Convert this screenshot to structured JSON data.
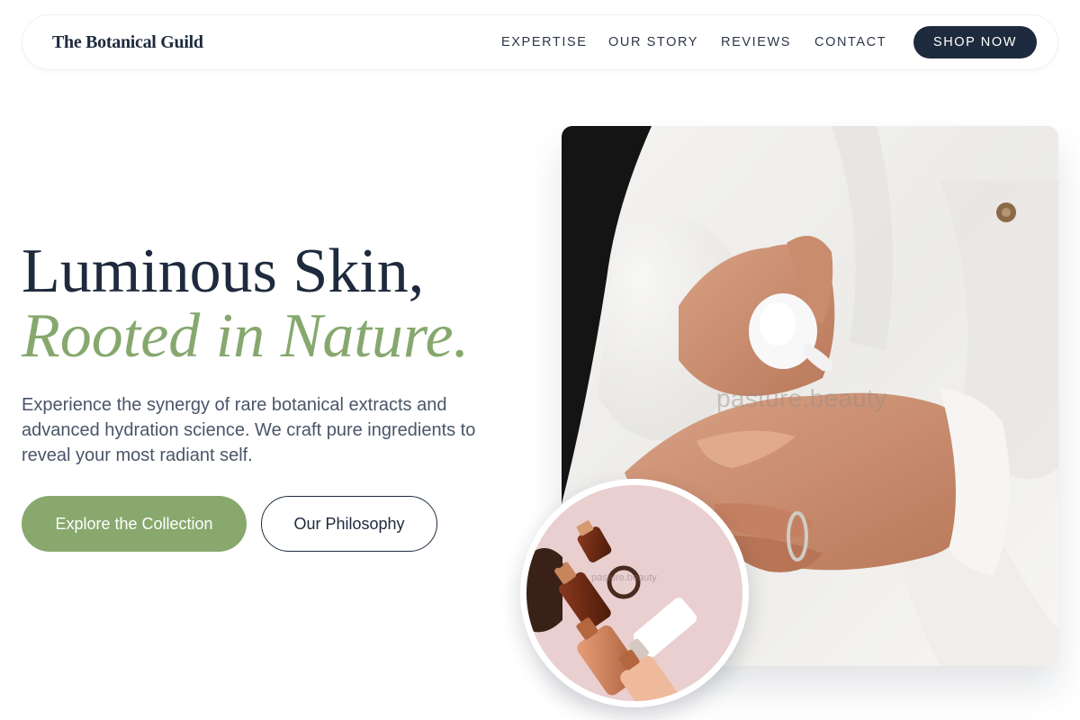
{
  "brand": {
    "name": "The Botanical Guild"
  },
  "nav": {
    "links": [
      "EXPERTISE",
      "OUR STORY",
      "REVIEWS",
      "CONTACT"
    ],
    "cta": "SHOP NOW"
  },
  "hero": {
    "headline_line1": "Luminous Skin,",
    "headline_line2": "Rooted in Nature.",
    "description": "Experience the synergy of rare botanical extracts and advanced hydration science. We craft pure ingredients to reveal your most radiant self.",
    "primary_button": "Explore the Collection",
    "secondary_button": "Our Philosophy"
  },
  "images": {
    "main_watermark": "pasture.beauty",
    "circle_watermark": "pasture.beauty"
  },
  "colors": {
    "navy": "#1e2a3d",
    "sage": "#86a86e",
    "text_muted": "#4a5568",
    "blush": "#e9cfcf"
  }
}
